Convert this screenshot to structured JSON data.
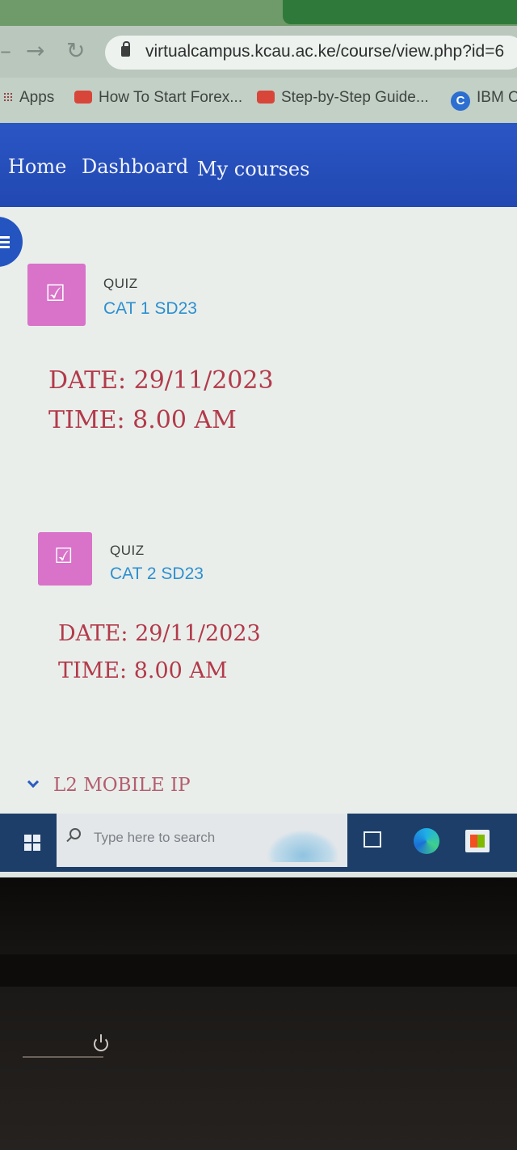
{
  "browser": {
    "address_url": "virtualcampus.kcau.ac.ke/course/view.php?id=6",
    "bookmarks": [
      {
        "label": "Apps",
        "icon": "apps-grid-icon"
      },
      {
        "label": "How To Start Forex...",
        "icon": "youtube-icon"
      },
      {
        "label": "Step-by-Step Guide...",
        "icon": "youtube-icon"
      },
      {
        "label": "IBM C",
        "icon": "ibm-c-icon"
      }
    ]
  },
  "navbar": {
    "items": [
      "Home",
      "Dashboard",
      "My courses"
    ],
    "color": "#2a56c4"
  },
  "activities": [
    {
      "type": "QUIZ",
      "name": "CAT 1 SD23",
      "date": "DATE: 29/11/2023",
      "time": "TIME: 8.00 AM"
    },
    {
      "type": "QUIZ",
      "name": "CAT 2 SD23",
      "date": "DATE: 29/11/2023",
      "time": "TIME: 8.00 AM"
    }
  ],
  "section": {
    "title": "L2 MOBILE IP"
  },
  "taskbar": {
    "search_placeholder": "Type here to search",
    "icons": [
      "windows-start-icon",
      "search-icon",
      "task-view-icon",
      "edge-icon",
      "store-icon"
    ]
  },
  "colors": {
    "quiz_icon": "#d873c9",
    "quiz_link": "#2e8fcf",
    "date_text": "#b33a4a",
    "taskbar": "#1d3e68"
  }
}
